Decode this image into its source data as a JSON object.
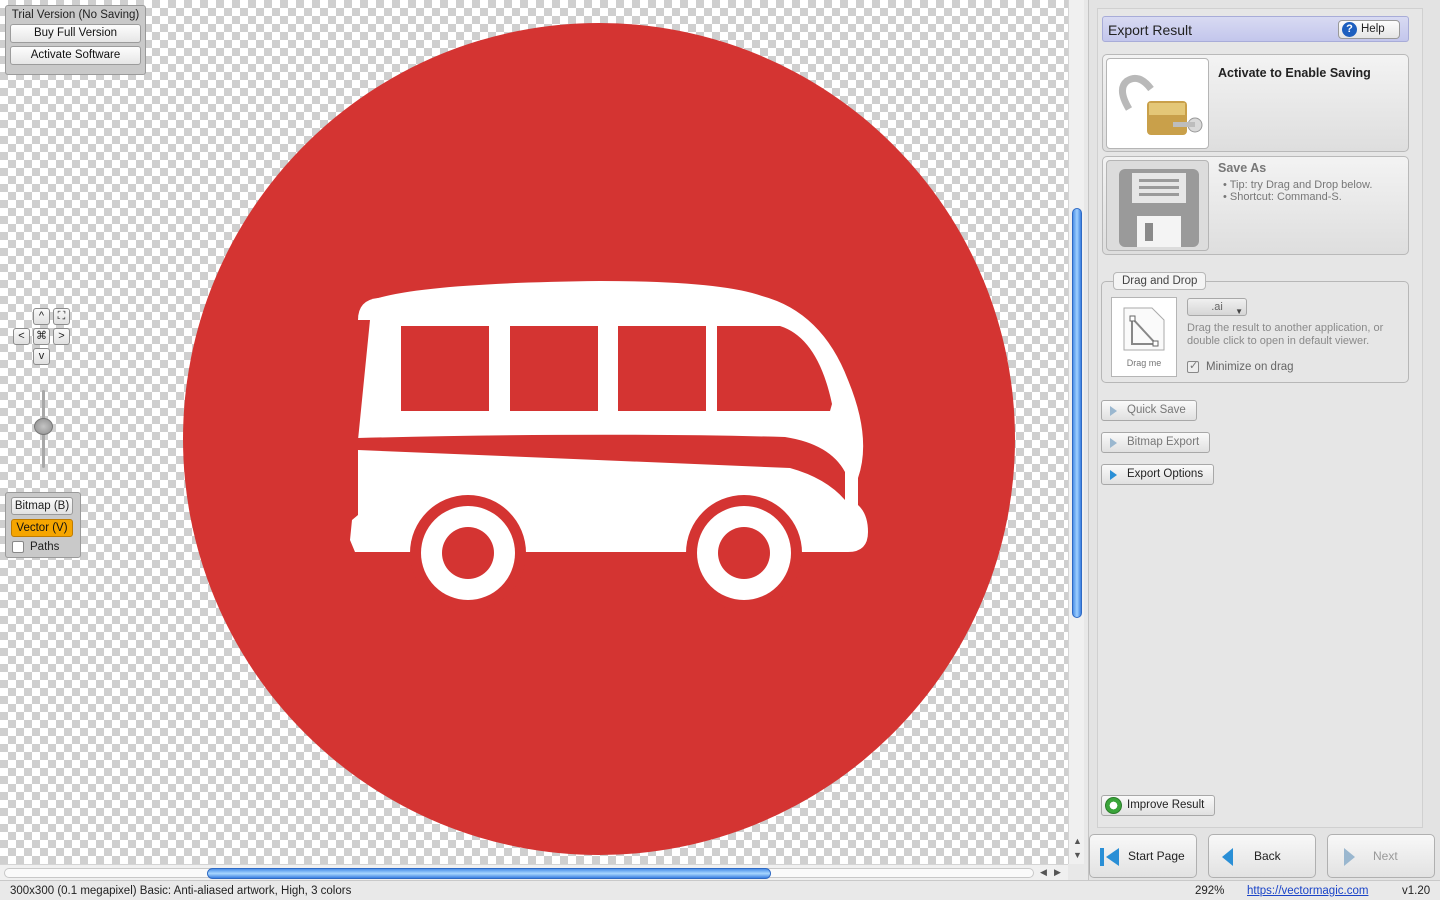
{
  "trial": {
    "title": "Trial Version (No Saving)",
    "buy_label": "Buy Full Version",
    "activate_label": "Activate Software"
  },
  "nav": {
    "up": "^",
    "down": "v",
    "left": "<",
    "right": ">"
  },
  "view": {
    "bitmap_label": "Bitmap (B)",
    "vector_label": "Vector (V)",
    "paths_label": "Paths",
    "active_mode": "vector"
  },
  "artwork": {
    "circle_color": "#d43432",
    "shape_color": "#ffffff"
  },
  "panel": {
    "title": "Export Result",
    "help_label": "Help",
    "activate_card_title": "Activate to Enable Saving",
    "save_as_title": "Save As",
    "save_as_tips": [
      "Tip: try Drag and Drop below.",
      "Shortcut: Command-S."
    ],
    "drag_drop": {
      "legend": "Drag and Drop",
      "tile_label": "Drag me",
      "format_value": ".ai",
      "hint": "Drag the result to another application, or double click to open in default viewer.",
      "minimize_label": "Minimize on drag"
    },
    "quick_save_label": "Quick Save",
    "bitmap_export_label": "Bitmap Export",
    "export_options_label": "Export Options",
    "improve_label": "Improve Result"
  },
  "footer_nav": {
    "start_label": "Start Page",
    "back_label": "Back",
    "next_label": "Next"
  },
  "status": {
    "info": "300x300 (0.1 megapixel)  Basic: Anti-aliased artwork, High, 3 colors",
    "zoom": "292%",
    "url": "https://vectormagic.com",
    "version": "v1.20"
  }
}
